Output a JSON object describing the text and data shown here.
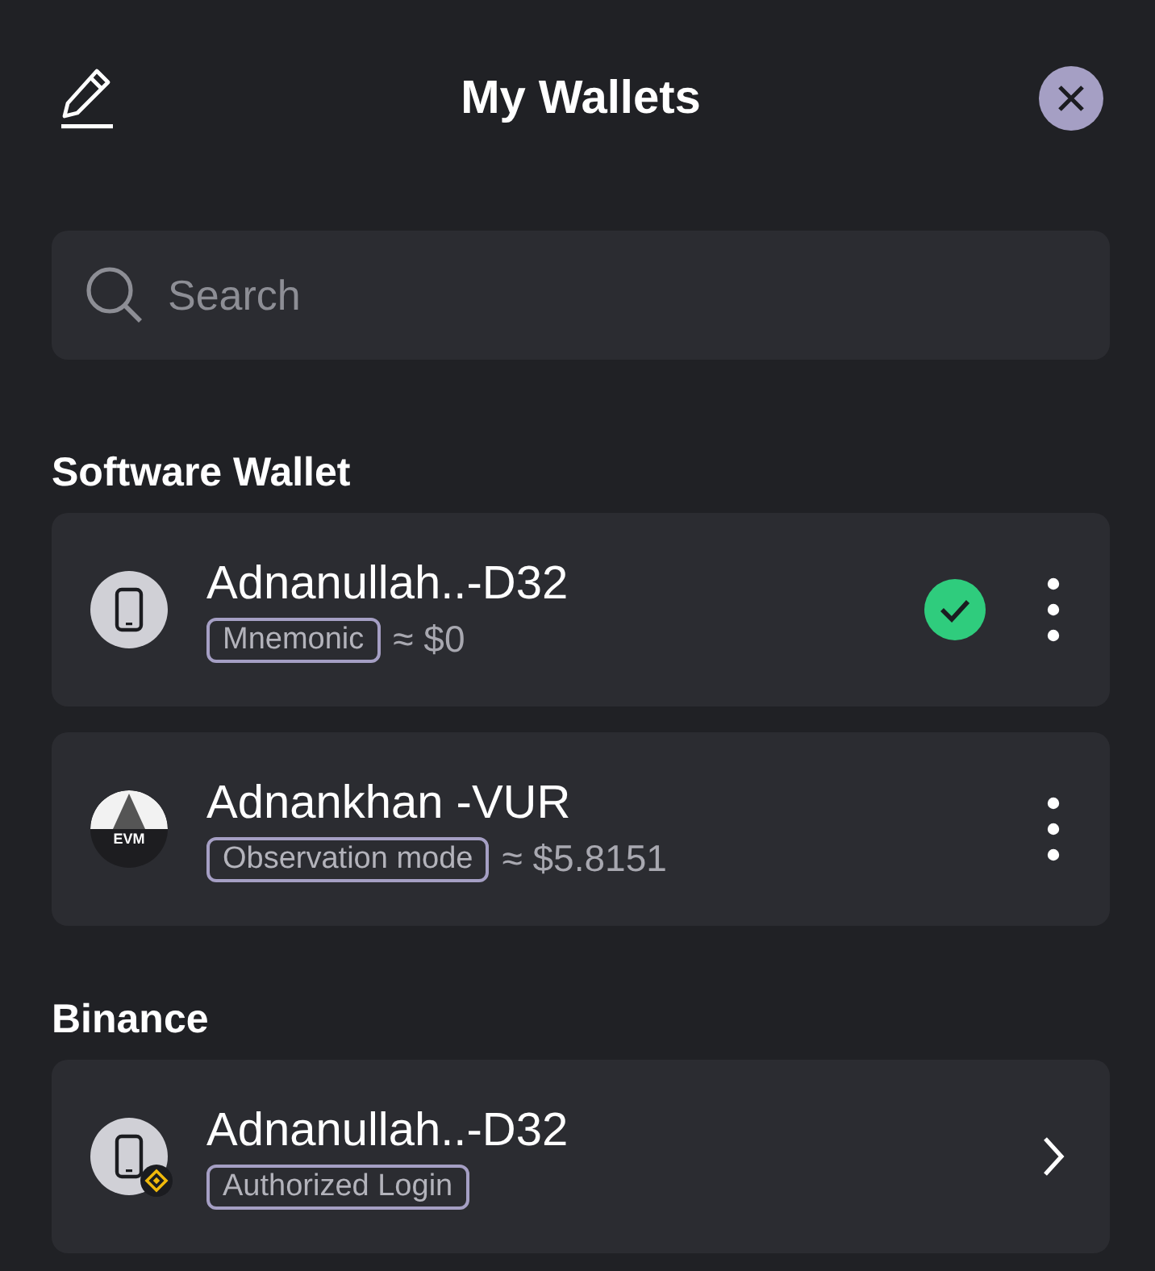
{
  "header": {
    "title": "My Wallets"
  },
  "search": {
    "placeholder": "Search"
  },
  "sections": [
    {
      "title": "Software Wallet",
      "wallets": [
        {
          "name": "Adnanullah..-D32",
          "avatar": {
            "kind": "phone"
          },
          "tag": "Mnemonic",
          "balance": "≈ $0",
          "selected": true,
          "action": {
            "kind": "menu"
          }
        },
        {
          "name": "Adnankhan -VUR",
          "avatar": {
            "kind": "evm",
            "label": "EVM"
          },
          "tag": "Observation mode",
          "balance": "≈ $5.8151",
          "selected": false,
          "action": {
            "kind": "menu"
          }
        }
      ]
    },
    {
      "title": "Binance",
      "wallets": [
        {
          "name": "Adnanullah..-D32",
          "avatar": {
            "kind": "phone-binance"
          },
          "tag": "Authorized Login",
          "selected": false,
          "action": {
            "kind": "chevron"
          }
        }
      ]
    }
  ]
}
